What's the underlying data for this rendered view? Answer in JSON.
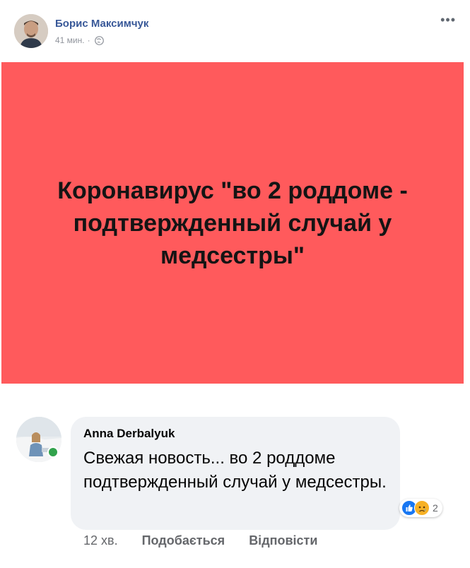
{
  "post": {
    "author_name": "Борис Максимчук",
    "time": "41 мин.",
    "meta_separator": "·",
    "privacy_icon": "globe-icon",
    "more_label": "•••",
    "headline": "Коронавирус \"во 2 роддоме - подтвержденный случай у медсестры\"",
    "image_background": "#ff5a5c"
  },
  "comment": {
    "author_name": "Anna Derbalyuk",
    "text": "Свежая новость... во 2 роддоме подтвержденный случай у медсестры.",
    "online": true,
    "reactions": {
      "icons": [
        "like-icon",
        "sad-icon"
      ],
      "count": "2"
    },
    "actions": {
      "time": "12 хв.",
      "like_label": "Подобається",
      "reply_label": "Відповісти"
    }
  },
  "colors": {
    "accent": "#385898",
    "like_blue": "#1877f2",
    "online_green": "#31a24c",
    "bubble_bg": "#f0f2f5"
  }
}
